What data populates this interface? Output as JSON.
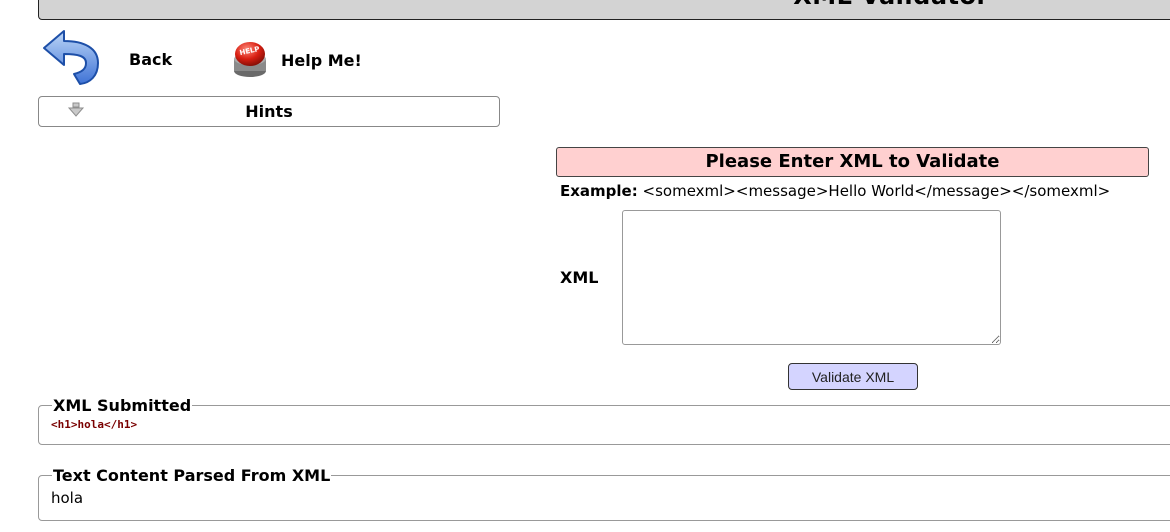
{
  "header": {
    "title": "XML Validator"
  },
  "nav": {
    "back_label": "Back",
    "help_label": "Help Me!",
    "help_badge": "HELP"
  },
  "hints": {
    "label": "Hints"
  },
  "form": {
    "header": "Please Enter XML to Validate",
    "example_label": "Example:",
    "example_text": "<somexml><message>Hello World</message></somexml>",
    "xml_label": "XML",
    "xml_value": "",
    "submit_label": "Validate XML"
  },
  "results": {
    "submitted_legend": "XML Submitted",
    "submitted_value": "<h1>hola</h1>",
    "parsed_legend": "Text Content Parsed From XML",
    "parsed_value": "hola"
  }
}
